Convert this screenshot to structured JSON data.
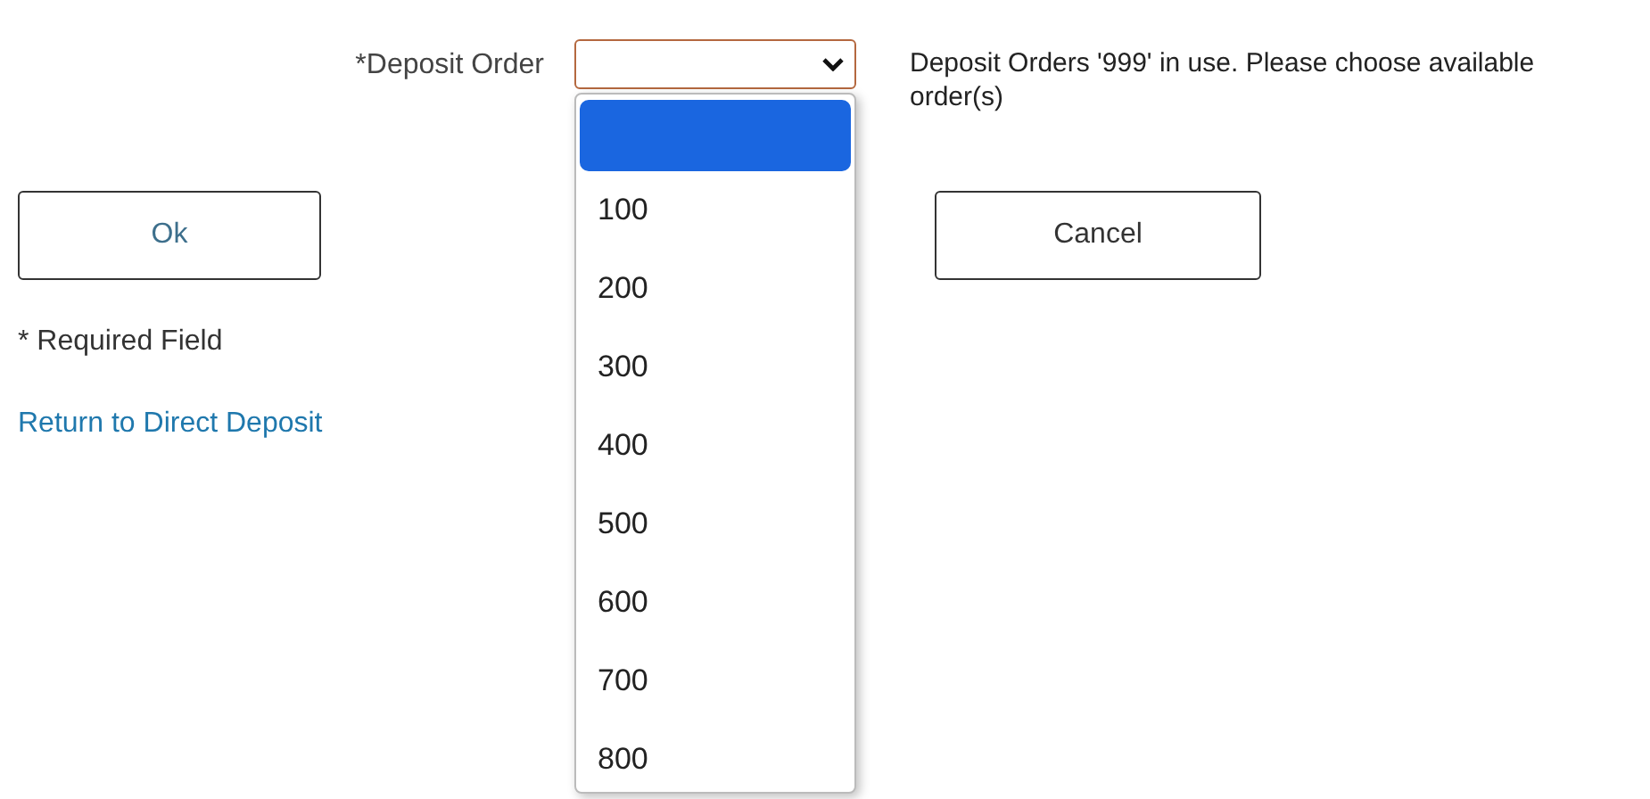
{
  "form": {
    "label": "*Deposit Order",
    "message": "Deposit Orders '999' in use. Please choose available order(s)"
  },
  "dropdown": {
    "expanded": true,
    "options": [
      {
        "kind": "blank",
        "selected": true
      },
      {
        "kind": "value",
        "label": "100",
        "selected": false
      },
      {
        "kind": "value",
        "label": "200",
        "selected": false
      },
      {
        "kind": "value",
        "label": "300",
        "selected": false
      },
      {
        "kind": "value",
        "label": "400",
        "selected": false
      },
      {
        "kind": "value",
        "label": "500",
        "selected": false
      },
      {
        "kind": "value",
        "label": "600",
        "selected": false
      },
      {
        "kind": "value",
        "label": "700",
        "selected": false
      },
      {
        "kind": "value",
        "label": "800",
        "selected": false
      }
    ]
  },
  "buttons": [
    {
      "label": "Ok"
    },
    {
      "label": "Cancel"
    }
  ],
  "required_note": "* Required Field",
  "link": "Return to Direct Deposit"
}
